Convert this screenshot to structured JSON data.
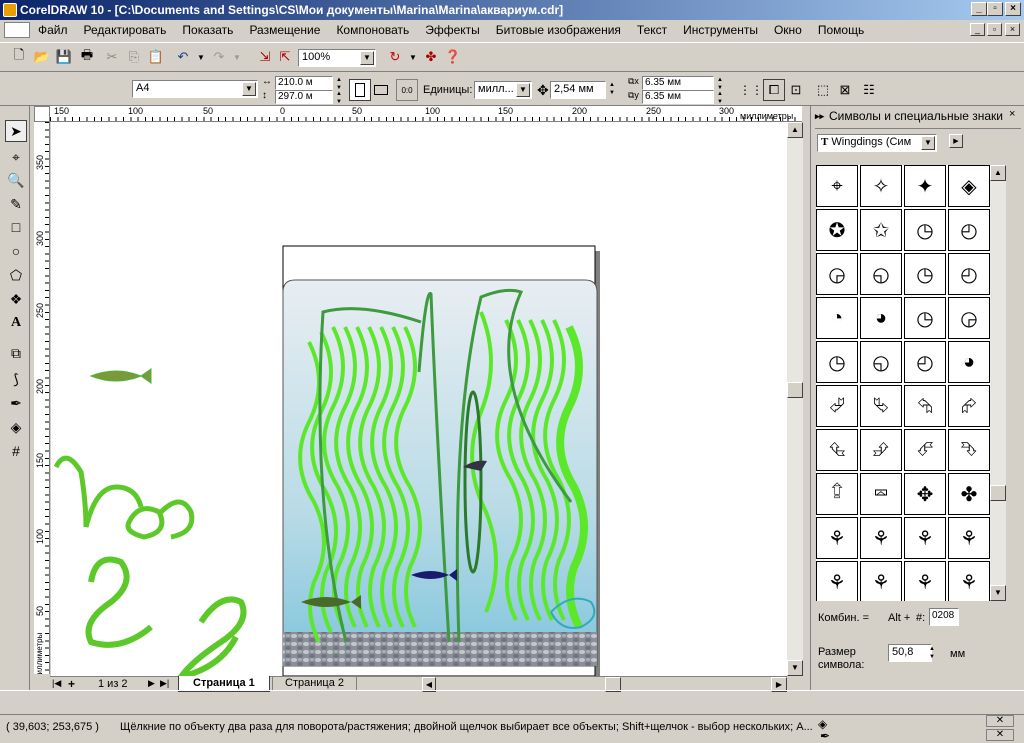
{
  "window": {
    "title": "CorelDRAW 10 - [C:\\Documents and Settings\\CS\\Мои документы\\Marina\\Marina\\аквариум.cdr]"
  },
  "menu": [
    "Файл",
    "Редактировать",
    "Показать",
    "Размещение",
    "Компоновать",
    "Эффекты",
    "Битовые изображения",
    "Текст",
    "Инструменты",
    "Окно",
    "Помощь"
  ],
  "toolbar": {
    "zoom": "100%"
  },
  "property_bar": {
    "paper_size": "A4",
    "width": "210.0 м",
    "height": "297.0 м",
    "units_label": "Единицы:",
    "units_value": "милл...",
    "nudge": "2,54 мм",
    "dup_x": "6.35 мм",
    "dup_y": "6.35 мм"
  },
  "rulers": {
    "h_ticks": [
      "150",
      "100",
      "50",
      "0",
      "50",
      "100",
      "150",
      "200",
      "250",
      "300"
    ],
    "h_unit": "миллиметры",
    "v_ticks": [
      "350",
      "300",
      "250",
      "200",
      "150",
      "100",
      "50"
    ],
    "v_unit": "миллиметры"
  },
  "page_tabs": {
    "counter": "1 из 2",
    "tabs": [
      "Страница 1",
      "Страница 2"
    ]
  },
  "docker": {
    "title": "Символы и специальные знаки",
    "font": "Wingdings (Сим",
    "combo_label": "Комбин. =",
    "combo_keys": "Alt +",
    "hash": "#:",
    "code": "0208",
    "size_label": "Размер символа:",
    "size_value": "50,8",
    "size_unit": "мм",
    "glyphs": [
      "⌖",
      "✧",
      "✦",
      "◈",
      "✪",
      "✩",
      "◷",
      "◴",
      "◶",
      "◵",
      "◷",
      "◴",
      "◔",
      "◕",
      "◷",
      "◶",
      "◷",
      "◵",
      "◴",
      "◕",
      "⮰",
      "⮱",
      "⮲",
      "⮳",
      "⮴",
      "⮵",
      "⮶",
      "⮷",
      "⮸",
      "⮹",
      "✥",
      "✤",
      "⚘",
      "⚘",
      "⚘",
      "⚘",
      "⚘",
      "⚘",
      "⚘",
      "⚘",
      "⌫",
      "⌦",
      "◄",
      "►"
    ]
  },
  "status": {
    "coords": "( 39,603; 253,675 )",
    "message": "Щёлкние по объекту два раза для поворота/растяжения; двойной щелчок выбирает все объекты; Shift+щелчок - выбор нескольких; A..."
  }
}
